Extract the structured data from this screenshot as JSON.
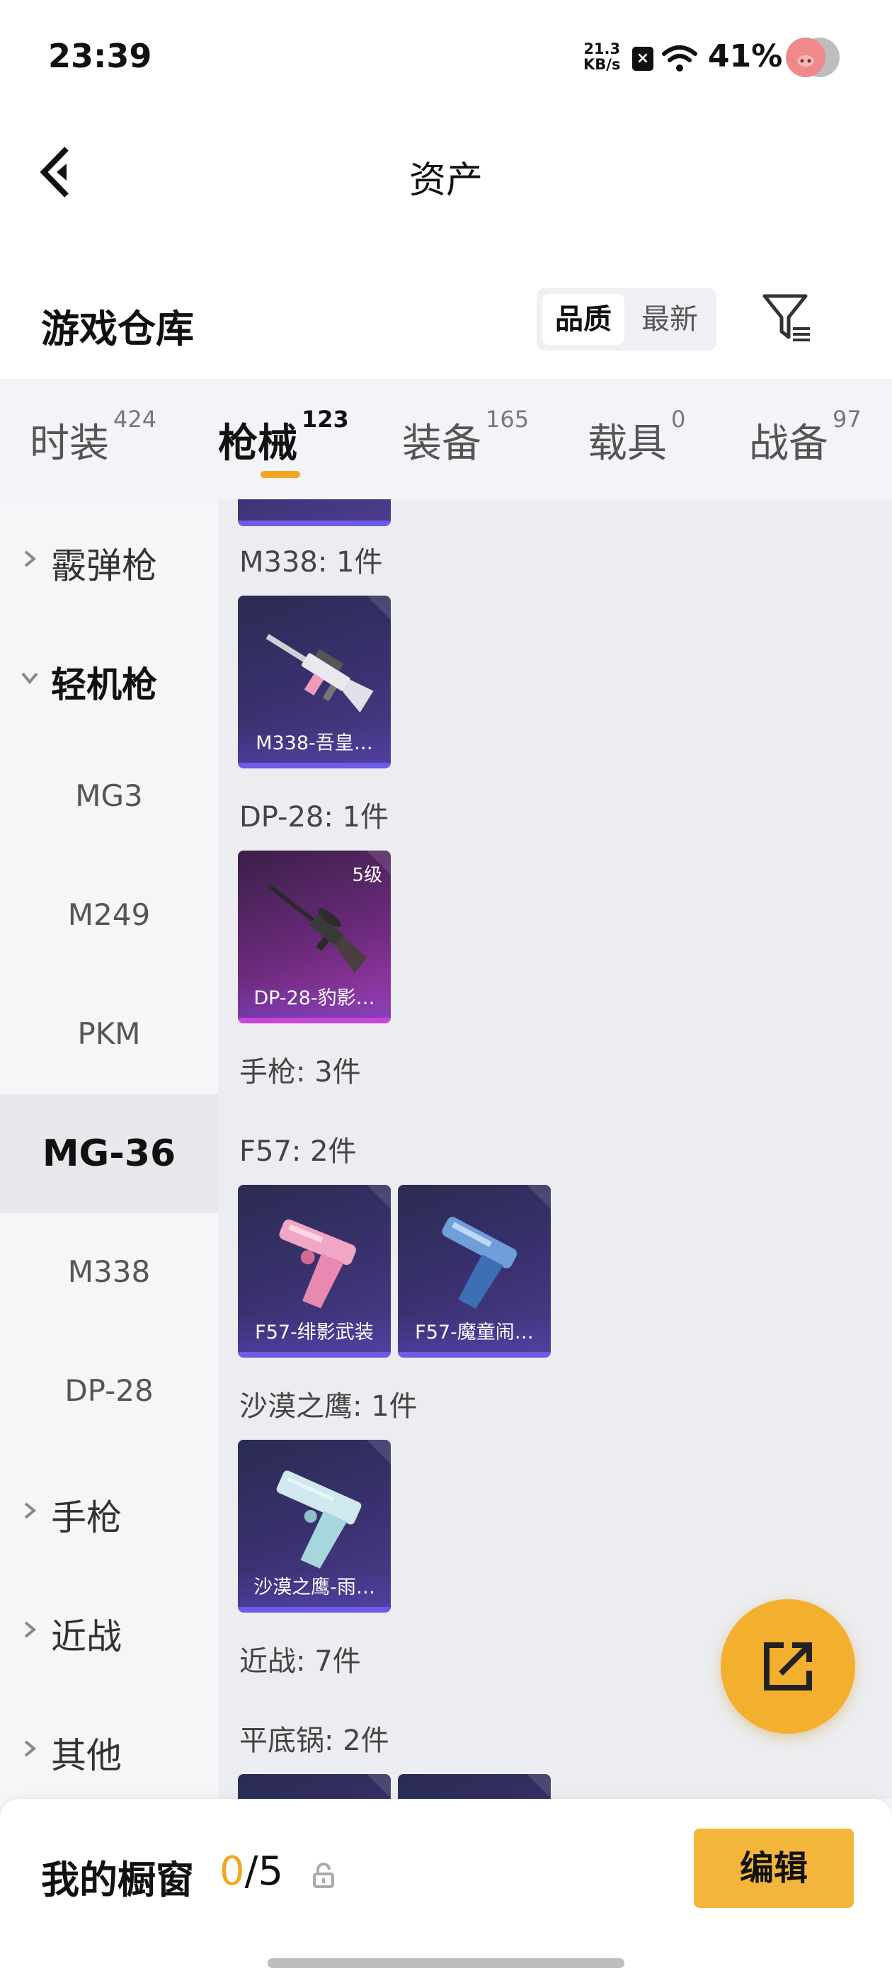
{
  "status_bar": {
    "time": "23:39",
    "net_speed_value": "21.3",
    "net_speed_unit": "KB/s",
    "sim_icon": "sim-disabled-icon",
    "wifi_icon": "wifi-icon",
    "battery": "41%",
    "avatar_icon": "pig-avatar-icon"
  },
  "header": {
    "back_icon": "back-arrow-icon",
    "title": "资产"
  },
  "section": {
    "title": "游戏仓库",
    "sort_options": [
      "品质",
      "最新"
    ],
    "sort_selected": "品质",
    "filter_icon": "filter-icon"
  },
  "tabs": [
    {
      "label": "时装",
      "count": "424"
    },
    {
      "label": "枪械",
      "count": "123"
    },
    {
      "label": "装备",
      "count": "165"
    },
    {
      "label": "载具",
      "count": "0"
    },
    {
      "label": "战备",
      "count": "97"
    }
  ],
  "active_tab": "枪械",
  "categories": {
    "shotgun": "霰弹枪",
    "lmg": "轻机枪",
    "lmg_items": [
      "MG3",
      "M249",
      "PKM",
      "MG-36",
      "M338",
      "DP-28"
    ],
    "selected_item": "MG-36",
    "pistol": "手枪",
    "melee": "近战",
    "other": "其他"
  },
  "content": {
    "m338_group": "M338: 1件",
    "m338_items": [
      {
        "name": "M338-吾皇…"
      }
    ],
    "dp28_group": "DP-28: 1件",
    "dp28_items": [
      {
        "name": "DP-28-豹影…",
        "level": "5级"
      }
    ],
    "pistol_section": "手枪: 3件",
    "f57_group": "F57: 2件",
    "f57_items": [
      {
        "name": "F57-绯影武装"
      },
      {
        "name": "F57-魔童闹…"
      }
    ],
    "deagle_group": "沙漠之鹰: 1件",
    "deagle_items": [
      {
        "name": "沙漠之鹰-雨…"
      }
    ],
    "melee_section": "近战: 7件",
    "pan_group": "平底锅: 2件"
  },
  "fab": {
    "icon": "share-export-icon"
  },
  "showcase": {
    "title": "我的橱窗",
    "current": "0",
    "total": "/5",
    "lock_icon": "lock-icon",
    "edit_label": "编辑"
  },
  "colors": {
    "accent": "#f4a623",
    "button_yellow": "#f3b63a",
    "card_purple": "#3a3170",
    "card_rare": "#a03cb0"
  }
}
